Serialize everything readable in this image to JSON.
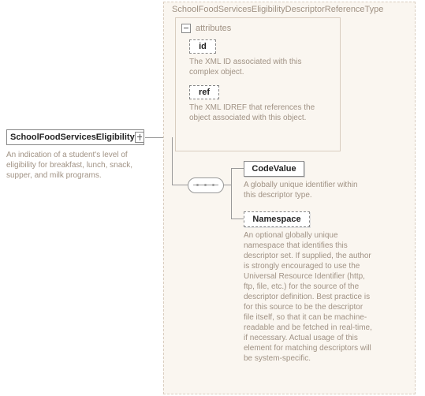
{
  "root": {
    "label": "SchoolFoodServicesEligibility",
    "description": "An indication of a student's level of eligibility for breakfast, lunch, snack, supper, and milk programs."
  },
  "group": {
    "title": "SchoolFoodServicesEligibilityDescriptorReferenceType",
    "attributes": {
      "header": "attributes",
      "id": {
        "label": "id",
        "description": "The XML ID associated with this complex object."
      },
      "ref": {
        "label": "ref",
        "description": "The XML IDREF that references the object associated with this object."
      }
    },
    "codeValue": {
      "label": "CodeValue",
      "description": "A globally unique identifier within this descriptor type."
    },
    "namespace": {
      "label": "Namespace",
      "description": "An optional globally unique namespace that identifies this descriptor set. If supplied, the author is strongly encouraged to use the Universal Resource Identifier (http, ftp, file, etc.) for the source of the descriptor definition. Best practice is for this source to be the descriptor file itself, so that it can be machine-readable and be fetched in real-time, if necessary. Actual usage of this element for matching descriptors will be system-specific."
    }
  }
}
